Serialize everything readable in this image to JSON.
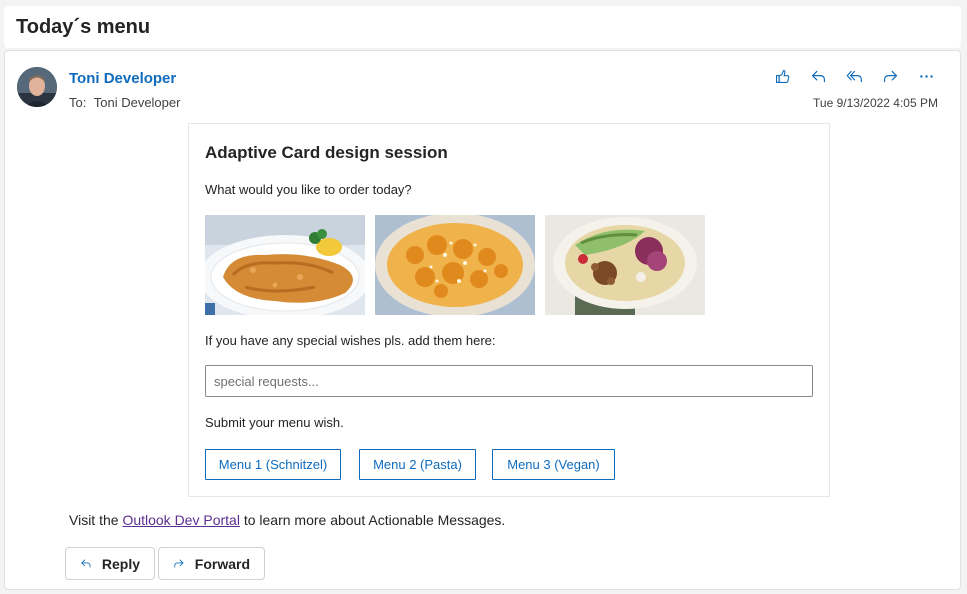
{
  "subject": "Today´s menu",
  "header": {
    "sender_name": "Toni Developer",
    "to_label": "To:",
    "to_name": "Toni Developer",
    "timestamp": "Tue 9/13/2022 4:05 PM",
    "actions": [
      "like-icon",
      "reply-icon",
      "reply-all-icon",
      "forward-icon",
      "more-icon"
    ]
  },
  "card": {
    "title": "Adaptive Card design session",
    "question": "What would you like to order today?",
    "images": [
      "schnitzel-image",
      "pasta-image",
      "vegan-bowl-image"
    ],
    "wish_label": "If you have any special wishes pls. add them here:",
    "wish_placeholder": "special requests...",
    "wish_value": "",
    "submit_label": "Submit your menu wish.",
    "buttons": [
      "Menu 1 (Schnitzel)",
      "Menu 2 (Pasta)",
      "Menu 3 (Vegan)"
    ]
  },
  "footer": {
    "prefix": "Visit the",
    "link_text": "Outlook Dev Portal",
    "suffix": "to learn more about Actionable Messages."
  },
  "buttons": {
    "reply": "Reply",
    "forward": "Forward"
  },
  "colors": {
    "accent": "#0f6cbd",
    "link_visited": "#5c2e91"
  }
}
